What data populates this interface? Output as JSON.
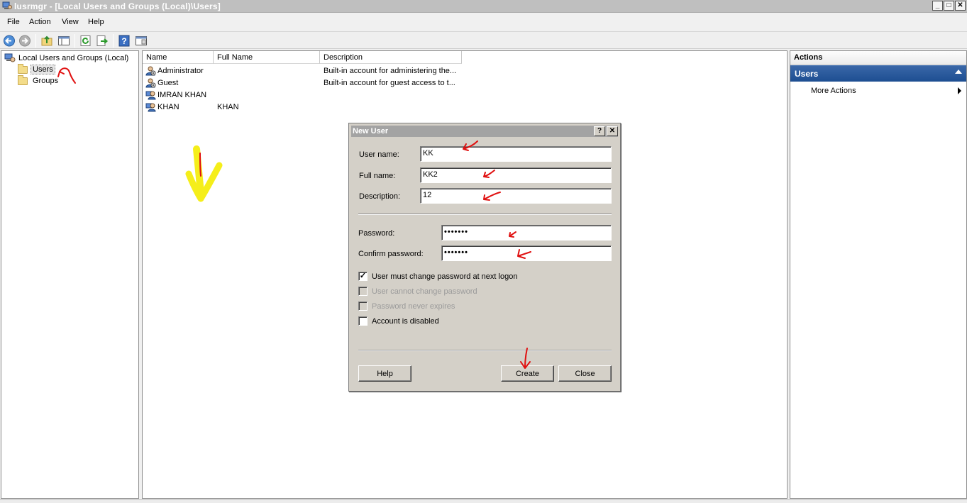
{
  "window": {
    "title": "lusrmgr - [Local Users and Groups (Local)\\Users]",
    "controls": [
      "_",
      "□",
      "✕"
    ]
  },
  "menu": [
    "File",
    "Action",
    "View",
    "Help"
  ],
  "toolbar_icons": [
    "back-arrow-icon",
    "forward-arrow-icon",
    "up-folder-icon",
    "show-hide-tree-icon",
    "refresh-icon",
    "export-list-icon",
    "help-icon",
    "properties-icon"
  ],
  "tree": {
    "root": "Local Users and Groups (Local)",
    "children": [
      "Users",
      "Groups"
    ],
    "selected": "Users"
  },
  "list": {
    "columns": [
      "Name",
      "Full Name",
      "Description"
    ],
    "rows": [
      {
        "name": "Administrator",
        "full_name": "",
        "description": "Built-in account for administering the..."
      },
      {
        "name": "Guest",
        "full_name": "",
        "description": "Built-in account for guest access to t..."
      },
      {
        "name": "IMRAN KHAN",
        "full_name": "",
        "description": ""
      },
      {
        "name": "KHAN",
        "full_name": "KHAN",
        "description": ""
      }
    ]
  },
  "actions": {
    "header": "Actions",
    "section": "Users",
    "item": "More Actions"
  },
  "dialog": {
    "title": "New User",
    "help_glyph": "?",
    "close_glyph": "✕",
    "user_name_label": "User name:",
    "user_name_value": "KK",
    "full_name_label": "Full name:",
    "full_name_value": "KK2",
    "description_label": "Description:",
    "description_value": "12",
    "password_label": "Password:",
    "password_value": "•••••••",
    "confirm_label": "Confirm password:",
    "confirm_value": "•••••••",
    "checkboxes": [
      {
        "label": "User must change password at next logon",
        "checked": true,
        "enabled": true
      },
      {
        "label": "User cannot change password",
        "checked": false,
        "enabled": false
      },
      {
        "label": "Password never expires",
        "checked": false,
        "enabled": false
      },
      {
        "label": "Account is disabled",
        "checked": false,
        "enabled": true
      }
    ],
    "help_button": "Help",
    "create_button": "Create",
    "close_button": "Close"
  },
  "colors": {
    "actions_section_bg": "#1d4e92",
    "annotation_red": "#e01010",
    "annotation_yellow": "#f5ee1a"
  }
}
